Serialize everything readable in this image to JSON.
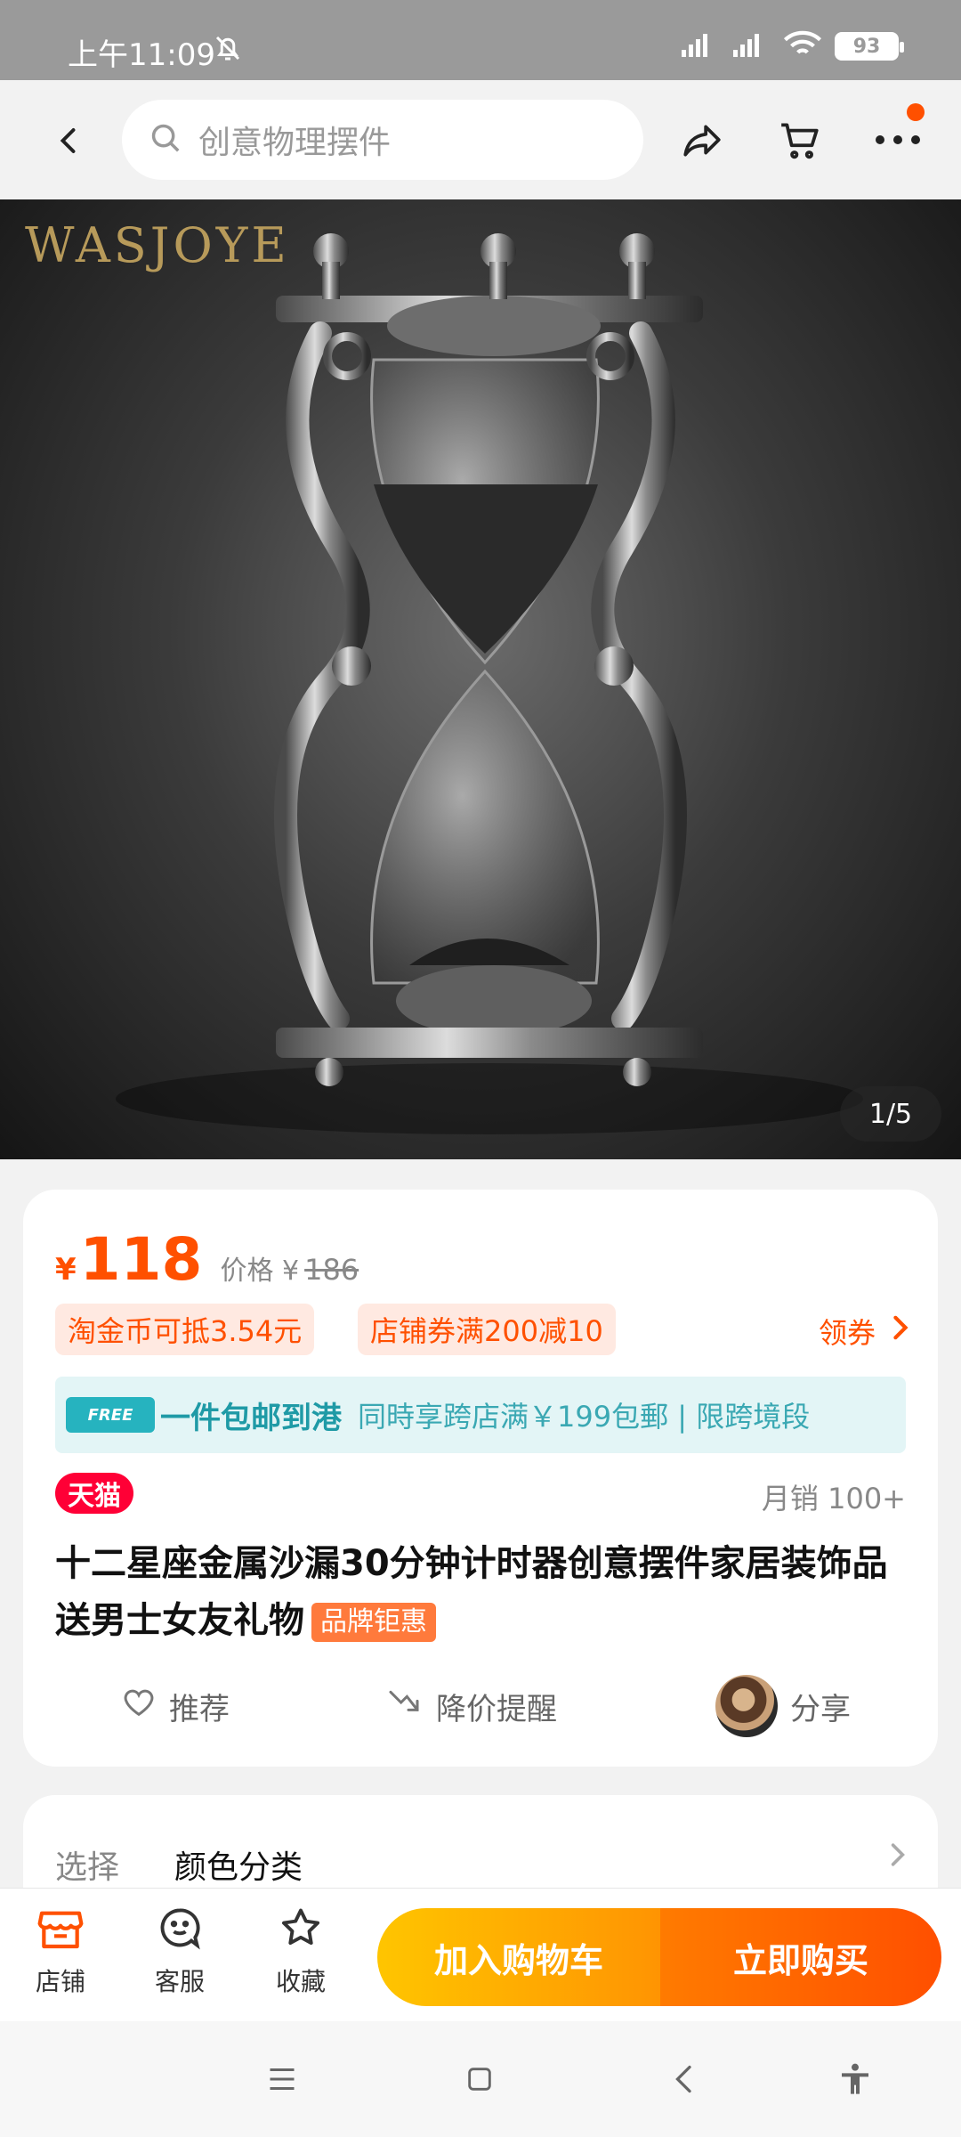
{
  "status_bar": {
    "time": "上午11:09",
    "battery": "93"
  },
  "header": {
    "search_placeholder": "创意物理摆件"
  },
  "hero": {
    "brand_watermark": "WASJOYE",
    "pager": "1/5"
  },
  "price_card": {
    "currency": "¥",
    "price": "118",
    "orig_label": "价格 ¥",
    "orig_price": "186",
    "tags": [
      "淘金币可抵3.54元",
      "店铺券满200减10"
    ],
    "coupon_label": "领券",
    "shipping": {
      "badge": "FREE",
      "main": "一件包邮到港",
      "sub": "同時享跨店满￥199包郵 | 限跨境段"
    },
    "tmall_badge": "天猫",
    "sales": "月销 100+",
    "title": "十二星座金属沙漏30分钟计时器创意摆件家居装饰品送男士女友礼物",
    "brand_deal": "品牌钜惠",
    "actions": {
      "recommend": "推荐",
      "price_alert": "降价提醒",
      "share": "分享"
    }
  },
  "select_card": {
    "label": "选择",
    "value": "颜色分类"
  },
  "bottom_bar": {
    "shop": "店铺",
    "service": "客服",
    "favorite": "收藏",
    "add_to_cart": "加入购物车",
    "buy_now": "立即购买"
  },
  "colors": {
    "accent": "#ff5000",
    "tmall": "#ff0036",
    "cart_gradient_start": "#ffc500",
    "buy_gradient_end": "#ff4f00"
  }
}
